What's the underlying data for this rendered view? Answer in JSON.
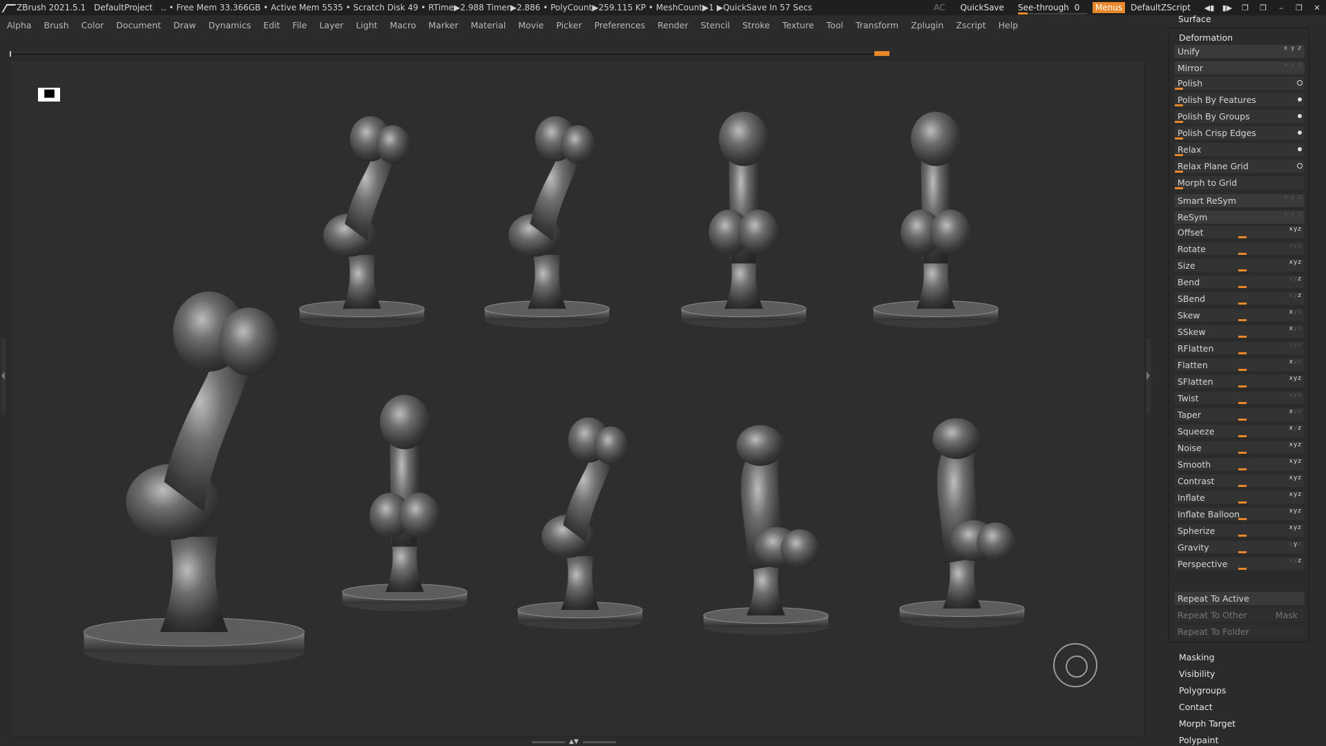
{
  "titlebar": {
    "app": "ZBrush 2021.5.1",
    "project": "DefaultProject",
    "stats": "..  • Free Mem 33.366GB • Active Mem 5535 • Scratch Disk 49 •  RTime▶2.988 Timer▶2.886 • PolyCount▶259.115 KP  • MeshCount▶1   ▶QuickSave In 57 Secs",
    "ac": "AC",
    "quicksave": "QuickSave",
    "see_through_label": "See-through",
    "see_through_value": "0",
    "menus": "Menus",
    "zscript": "DefaultZScript",
    "panel_header": "Surface"
  },
  "menubar": [
    "Alpha",
    "Brush",
    "Color",
    "Document",
    "Draw",
    "Dynamics",
    "Edit",
    "File",
    "Layer",
    "Light",
    "Macro",
    "Marker",
    "Material",
    "Movie",
    "Picker",
    "Preferences",
    "Render",
    "Stencil",
    "Stroke",
    "Texture",
    "Tool",
    "Transform",
    "Zplugin",
    "Zscript",
    "Help"
  ],
  "panel": {
    "deformation_title": "Deformation",
    "unify": "Unify",
    "mirror": "Mirror",
    "polish": "Polish",
    "polish_features": "Polish By Features",
    "polish_groups": "Polish By Groups",
    "polish_crisp": "Polish Crisp Edges",
    "relax": "Relax",
    "relax_plane": "Relax Plane Grid",
    "morph_grid": "Morph to Grid",
    "smart_resym": "Smart ReSym",
    "resym": "ReSym",
    "sliders": [
      "Offset",
      "Rotate",
      "Size",
      "Bend",
      "SBend",
      "Skew",
      "SSkew",
      "RFlatten",
      "Flatten",
      "SFlatten",
      "Twist",
      "Taper",
      "Squeeze",
      "Noise",
      "Smooth",
      "Contrast",
      "Inflate",
      "Inflate Balloon",
      "Spherize",
      "Gravity",
      "Perspective"
    ],
    "xyz": "x y z",
    "repeat_active": "Repeat To Active",
    "repeat_other": "Repeat To Other",
    "mask": "Mask",
    "repeat_folder": "Repeat To Folder",
    "subpalettes": [
      "Masking",
      "Visibility",
      "Polygroups",
      "Contact",
      "Morph Target",
      "Polypaint"
    ]
  },
  "canvas": {
    "hud_icon": "zbrush-hud-icon",
    "gizmo_icon": "navigation-gizmo-icon"
  },
  "colors": {
    "accent": "#e8882a",
    "background": "#2b2b2b",
    "panel_row": "#3a3a3a"
  }
}
